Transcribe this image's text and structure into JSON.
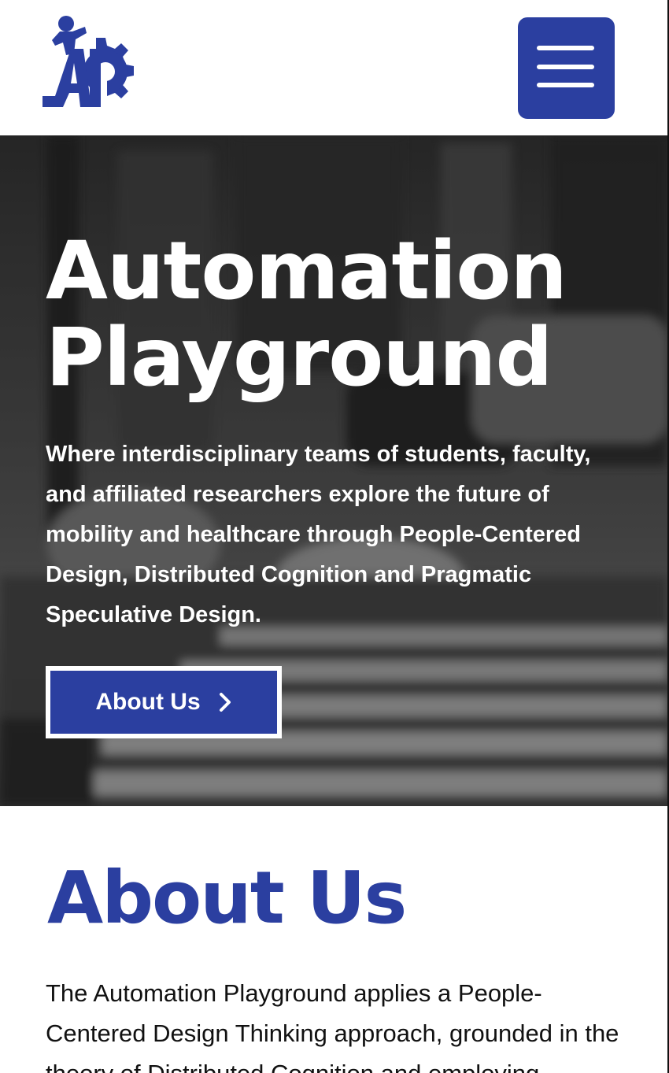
{
  "header": {
    "logo_alt": "Automation Playground logo",
    "logo_icon": "gear-figure-logo",
    "menu_icon": "hamburger-menu-icon",
    "brand_color": "#2b3fa0"
  },
  "hero": {
    "title_line1": "Automation",
    "title_line2": "Playground",
    "subtitle": "Where interdisciplinary teams of students, faculty, and affiliated researchers explore the future of mobility and healthcare through People-Centered Design, Distributed Cognition and Pragmatic Speculative Design.",
    "cta_label": "About Us",
    "cta_icon": "chevron-right-icon"
  },
  "about": {
    "heading": "About Us",
    "body": "The Automation Playground applies a People-Centered Design Thinking approach, grounded in the theory of Distributed Cognition and employing"
  }
}
